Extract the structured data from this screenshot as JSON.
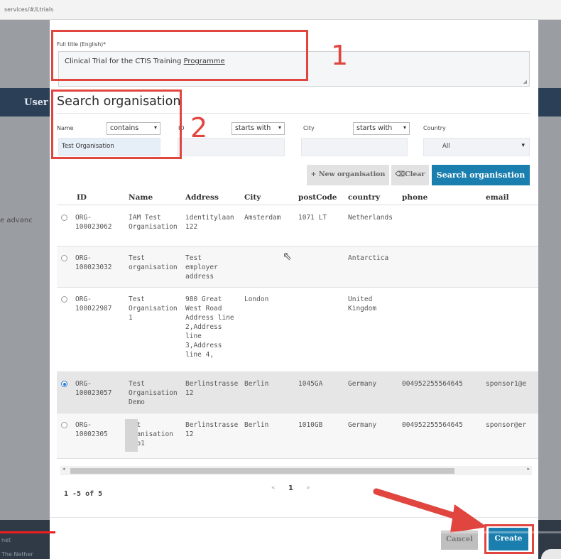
{
  "browser": {
    "url": "services/#/Ltrials"
  },
  "background": {
    "user_label": "User",
    "advanced_label": "e advanc",
    "footer_net": "net",
    "footer_country": "The Nether"
  },
  "form": {
    "full_title_label": "Full title (English)*",
    "full_title_value_prefix": "Clinical Trial for the CTIS Training ",
    "full_title_value_underlined": "Programme"
  },
  "search": {
    "heading": "Search organisation",
    "name_label": "Name",
    "name_operator": "contains",
    "name_value": "Test Organisation",
    "id_label": "ID",
    "id_operator": "starts with",
    "city_label": "City",
    "city_operator": "starts with",
    "country_label": "Country",
    "country_value": "All",
    "new_org_button": "+ New organisation",
    "clear_button": "Clear",
    "search_button": "Search organisation"
  },
  "table": {
    "columns": [
      "ID",
      "Name",
      "Address",
      "City",
      "postCode",
      "country",
      "phone",
      "email"
    ],
    "rows": [
      {
        "id": "ORG-\n100023062",
        "name": "IAM Test\nOrganisation",
        "address": "identitylaan\n122",
        "city": "Amsterdam",
        "postcode": "1071 LT",
        "country": "Netherlands",
        "phone": "",
        "email": "",
        "selected": false
      },
      {
        "id": "ORG-\n100023032",
        "name": "Test\norganisation",
        "address": "Test\nemployer\naddress",
        "city": "",
        "postcode": "",
        "country": "Antarctica",
        "phone": "",
        "email": "",
        "selected": false
      },
      {
        "id": "ORG-\n100022987",
        "name": "Test\nOrganisation\n1",
        "address": "980 Great\nWest Road\nAddress line\n2,Address\nline\n3,Address\nline 4,",
        "city": "London",
        "postcode": "",
        "country": "United\nKingdom",
        "phone": "",
        "email": "",
        "selected": false
      },
      {
        "id": "ORG-\n100023057",
        "name": "Test\nOrganisation\nDemo",
        "address": "Berlinstrasse\n12",
        "city": "Berlin",
        "postcode": "1045GA",
        "country": "Germany",
        "phone": "004952255564645",
        "email": "sponsor1@e",
        "selected": true
      },
      {
        "id": "ORG-\n10002305",
        "name": "est\nrganisation\nemo1",
        "address": "Berlinstrasse\n12",
        "city": "Berlin",
        "postcode": "1010GB",
        "country": "Germany",
        "phone": "004952255564645",
        "email": "sponsor@er",
        "selected": false
      }
    ]
  },
  "pagination": {
    "summary": "1 -5 of 5",
    "prev": "«",
    "current": "1",
    "next": "»"
  },
  "footer": {
    "cancel_label": "Cancel",
    "create_label": "Create"
  },
  "annotations": {
    "marker_1": "1",
    "marker_2": "2"
  },
  "colors": {
    "accent": "#1a7eae",
    "annotation": "#e0463f",
    "navbar": "#2b3f56",
    "video_progress": "#ee1c1c"
  },
  "video": {
    "progress_fraction": 0.1
  }
}
